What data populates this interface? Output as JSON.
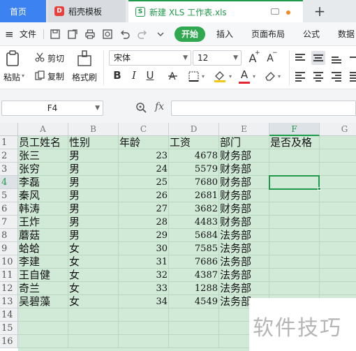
{
  "tabs": {
    "home": "首页",
    "template": "稻壳模板",
    "template_icon": "D",
    "document": "新建 XLS 工作表.xls",
    "document_icon": "S",
    "new_tab": "+"
  },
  "menu": {
    "hamburger": "≡",
    "file": "文件",
    "start": "开始",
    "insert": "插入",
    "page_layout": "页面布局",
    "formula": "公式",
    "data": "数据"
  },
  "ribbon": {
    "paste": "粘贴",
    "cut": "剪切",
    "copy": "复制",
    "format_painter": "格式刷",
    "font_name": "宋体",
    "font_size": "12",
    "bold": "B",
    "italic": "I",
    "underline": "U",
    "grow": "A",
    "shrink": "A",
    "font_color": "A"
  },
  "formula_bar": {
    "cell_ref": "F4",
    "fx": "fx",
    "value": ""
  },
  "columns": [
    "A",
    "B",
    "C",
    "D",
    "E",
    "F",
    "G"
  ],
  "active_column": "F",
  "rows": [
    "1",
    "2",
    "3",
    "4",
    "5",
    "6",
    "7",
    "8",
    "9",
    "10",
    "11",
    "12",
    "13",
    "14",
    "15",
    "16"
  ],
  "active_row": "4",
  "table": {
    "headers": [
      "员工姓名",
      "性别",
      "年龄",
      "工资",
      "部门",
      "是否及格"
    ],
    "records": [
      [
        "张三",
        "男",
        "23",
        "4678",
        "财务部"
      ],
      [
        "张穷",
        "男",
        "24",
        "5579",
        "财务部"
      ],
      [
        "李磊",
        "男",
        "25",
        "7680",
        "财务部"
      ],
      [
        "秦风",
        "男",
        "26",
        "2681",
        "财务部"
      ],
      [
        "韩涛",
        "男",
        "27",
        "3682",
        "财务部"
      ],
      [
        "王炸",
        "男",
        "28",
        "4483",
        "财务部"
      ],
      [
        "蘑菇",
        "男",
        "29",
        "5684",
        "法务部"
      ],
      [
        "蛤蛤",
        "女",
        "30",
        "7585",
        "法务部"
      ],
      [
        "李建",
        "女",
        "31",
        "7686",
        "法务部"
      ],
      [
        "王自健",
        "女",
        "32",
        "4387",
        "法务部"
      ],
      [
        "奇兰",
        "女",
        "33",
        "1288",
        "法务部"
      ],
      [
        "吴碧藻",
        "女",
        "34",
        "4549",
        "法务部"
      ]
    ]
  },
  "watermark": "软件技巧",
  "colors": {
    "accent_green": "#1e9a4a",
    "home_tab_blue": "#3c82f0",
    "cell_fill": "#d0ead7"
  }
}
